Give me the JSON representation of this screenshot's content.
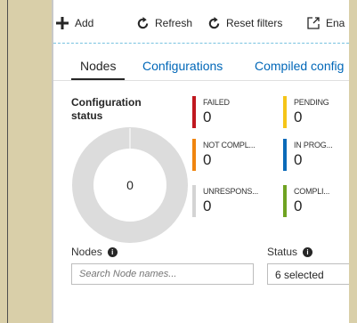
{
  "toolbar": {
    "add_label": "Add",
    "refresh_label": "Refresh",
    "reset_filters_label": "Reset filters",
    "enable_label": "Ena"
  },
  "tabs": [
    {
      "label": "Nodes"
    },
    {
      "label": "Configurations"
    },
    {
      "label": "Compiled config"
    }
  ],
  "config_status": {
    "title": "Configuration status",
    "total": "0"
  },
  "stats": [
    {
      "label": "FAILED",
      "value": "0",
      "color": "#c0181f"
    },
    {
      "label": "PENDING",
      "value": "0",
      "color": "#f5c518"
    },
    {
      "label": "NOT COMPL...",
      "value": "0",
      "color": "#f0850f"
    },
    {
      "label": "IN PROG...",
      "value": "0",
      "color": "#0a6ab9"
    },
    {
      "label": "UNRESPONS...",
      "value": "0",
      "color": "#d4d4d4"
    },
    {
      "label": "COMPLI...",
      "value": "0",
      "color": "#6fa321"
    }
  ],
  "filters": {
    "nodes_label": "Nodes",
    "nodes_placeholder": "Search Node names...",
    "status_label": "Status",
    "status_value": "6 selected"
  },
  "colors": {
    "donut": "#dcdcdc",
    "accent_link": "#0067b8"
  }
}
